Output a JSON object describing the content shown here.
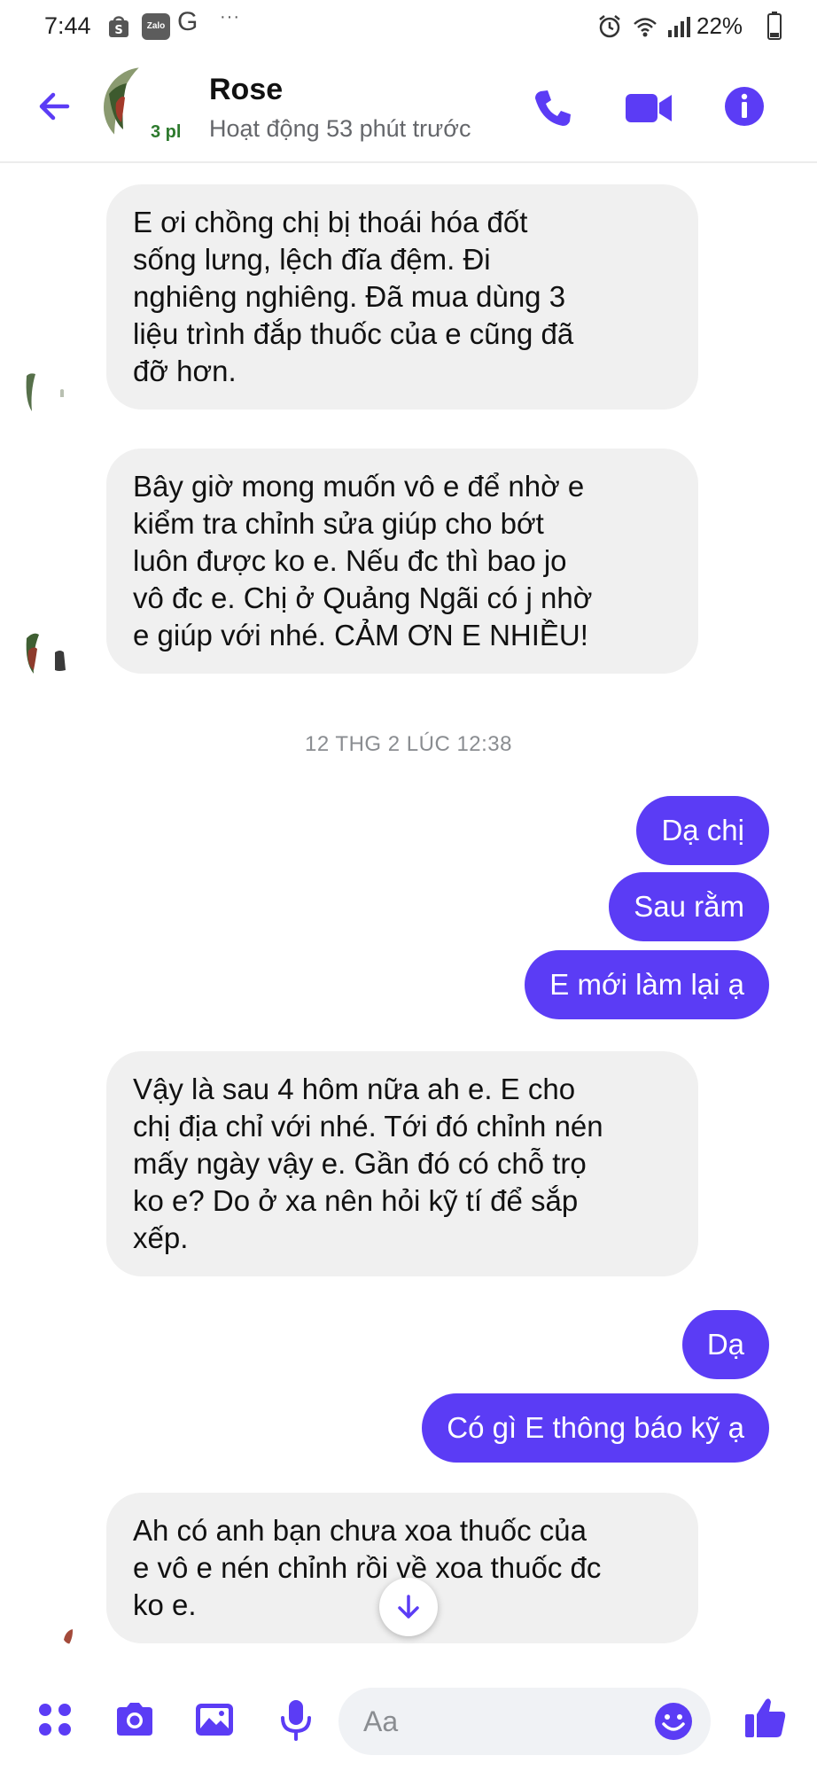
{
  "status_bar": {
    "time": "7:44",
    "zalo_label": "Zalo",
    "more_glyph": "···",
    "battery": "22%"
  },
  "header": {
    "name": "Rose",
    "status": "Hoạt động 53 phút trước",
    "avatar_badge": "3 pl",
    "accent_color": "#5b3cf5"
  },
  "messages": [
    {
      "direction": "incoming",
      "text": "E ơi chồng chị bị thoái hóa đốt\nsống lưng, lệch đĩa đệm. Đi\nnghiêng nghiêng. Đã mua dùng 3\nliệu trình đắp thuốc của e cũng đã\nđỡ hơn."
    },
    {
      "direction": "incoming",
      "text": "Bây giờ mong muốn vô e để nhờ e\nkiểm tra chỉnh sửa giúp cho bớt\nluôn được ko e. Nếu đc thì bao jo\nvô đc e. Chị ở Quảng Ngãi có j nhờ\ne giúp với nhé. CẢM ƠN E NHIỀU!"
    },
    {
      "direction": "outgoing",
      "text": "Dạ chị"
    },
    {
      "direction": "outgoing",
      "text": "Sau rằm"
    },
    {
      "direction": "outgoing",
      "text": "E mới làm lại ạ"
    },
    {
      "direction": "incoming",
      "text": "Vậy là sau 4 hôm nữa ah e. E cho\nchị địa chỉ với nhé. Tới đó chỉnh nén\nmấy ngày vậy e. Gần đó có chỗ trọ\nko e? Do ở xa nên hỏi kỹ tí để sắp\nxếp."
    },
    {
      "direction": "outgoing",
      "text": "Dạ"
    },
    {
      "direction": "outgoing",
      "text": "Có gì E thông báo kỹ ạ"
    },
    {
      "direction": "incoming",
      "text": "Ah có anh bạn chưa xoa thuốc của\ne vô e nén chỉnh rồi về xoa thuốc đc\nko e."
    }
  ],
  "timestamp": "12 THG 2 LÚC 12:38",
  "composer": {
    "placeholder": "Aa"
  },
  "icons": {
    "back": "arrow-left",
    "call": "phone",
    "video": "video-camera",
    "info": "info-circle",
    "more": "four-dots",
    "camera": "camera",
    "gallery": "image",
    "mic": "microphone",
    "emoji": "smiley",
    "like": "thumbs-up",
    "scroll": "arrow-down"
  }
}
